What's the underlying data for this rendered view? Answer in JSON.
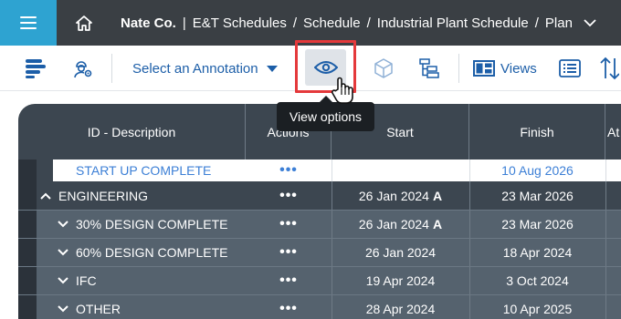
{
  "topbar": {
    "company": "Nate Co.",
    "crumbs": [
      "E&T Schedules",
      "Schedule",
      "Industrial Plant Schedule",
      "Plan"
    ],
    "sep1": "|",
    "sep": "/",
    "accent": "#2ea3d1"
  },
  "toolbar": {
    "annotation_label": "Select an Annotation",
    "views_label": "Views"
  },
  "tooltip": "View options",
  "grid": {
    "columns": [
      "ID - Description",
      "Actions",
      "Start",
      "Finish",
      "At"
    ],
    "rows": [
      {
        "label": "START UP COMPLETE",
        "actions": "•••",
        "start": "",
        "finish": "10 Aug 2026",
        "style": "white"
      },
      {
        "label": "ENGINEERING",
        "actions": "•••",
        "start": "26 Jan 2024",
        "start_flag": "A",
        "finish": "23 Mar 2026",
        "style": "dark"
      },
      {
        "label": "30% DESIGN COMPLETE",
        "actions": "•••",
        "start": "26 Jan 2024",
        "start_flag": "A",
        "finish": "23 Mar 2026",
        "style": "mid"
      },
      {
        "label": "60% DESIGN COMPLETE",
        "actions": "•••",
        "start": "26 Jan 2024",
        "finish": "18 Apr 2024",
        "style": "mid"
      },
      {
        "label": "IFC",
        "actions": "•••",
        "start": "19 Apr 2024",
        "finish": "3 Oct 2024",
        "style": "mid"
      },
      {
        "label": "OTHER",
        "actions": "•••",
        "start": "28 Apr 2024",
        "finish": "10 Apr 2025",
        "style": "mid"
      }
    ]
  },
  "colors": {
    "topbar_bg": "#3a3f44",
    "link_blue": "#1c5ea8",
    "highlight_red": "#e4393b",
    "grid_header": "#3c4650",
    "grid_row_mid": "#55626e"
  }
}
